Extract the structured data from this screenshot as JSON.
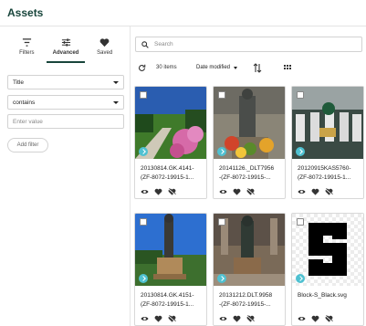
{
  "header": {
    "title": "Assets"
  },
  "tabs": [
    {
      "label": "Filters",
      "icon": "filter-icon"
    },
    {
      "label": "Advanced",
      "icon": "sliders-icon",
      "active": true
    },
    {
      "label": "Saved",
      "icon": "heart-icon"
    }
  ],
  "filter": {
    "field_value": "Title",
    "operator_value": "contains",
    "value_placeholder": "Enter value",
    "add_label": "Add filter"
  },
  "search": {
    "placeholder": "Search"
  },
  "toolbar": {
    "count": "30 items",
    "sort_label": "Date modified"
  },
  "assets": [
    {
      "line1": "20130814.GK.4141-",
      "line2": "(ZF-8072-19915-1..."
    },
    {
      "line1": "20141126._DLT7956",
      "line2": "-(ZF-8072-19915-..."
    },
    {
      "line1": "20120915KAS5760-",
      "line2": "(ZF-8072-19915-1..."
    },
    {
      "line1": "20130814.GK.4151-",
      "line2": "(ZF-8072-19915-1..."
    },
    {
      "line1": "20131212.DLT.9958",
      "line2": "-(ZF-8072-19915-..."
    },
    {
      "line1": "Block-S_Black.svg",
      "line2": ""
    }
  ],
  "colors": {
    "brand": "#18453b",
    "share": "#4fc1d1"
  }
}
